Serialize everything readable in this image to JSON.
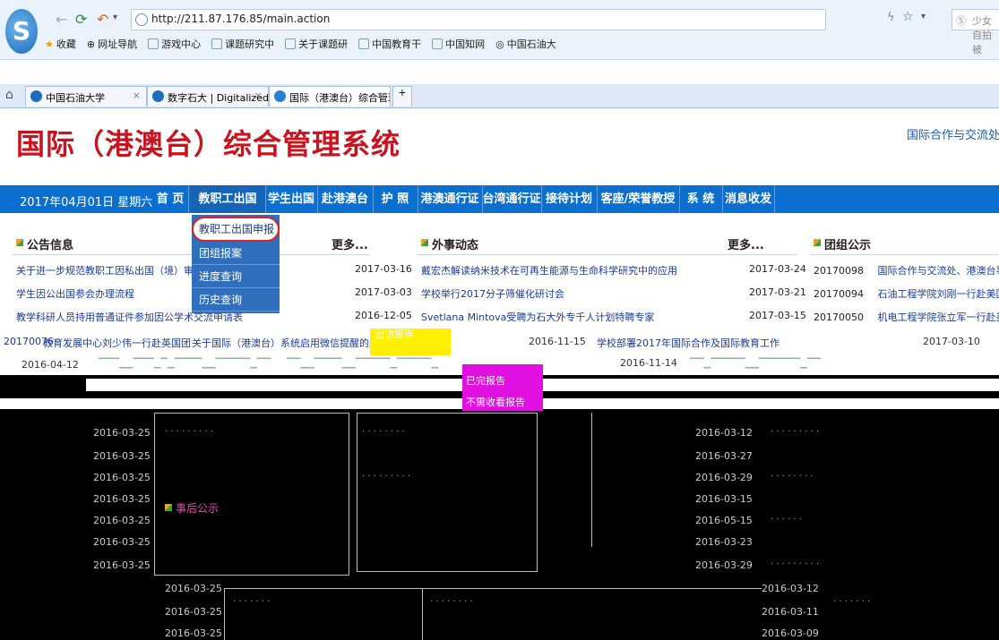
{
  "browser": {
    "url": "http://211.87.176.85/main.action",
    "right_search_text": "少女自拍被",
    "bookmarks": [
      "收藏",
      "网址导航",
      "游戏中心",
      "课题研究中",
      "关于课题研",
      "中国教育干",
      "中国知网",
      "中国石油大"
    ],
    "tabs": [
      {
        "label": "中国石油大学"
      },
      {
        "label": "数字石大 | Digitalized"
      },
      {
        "label": "国际（港澳台）综合管理"
      }
    ],
    "new_tab": "+"
  },
  "page": {
    "title": "国际（港澳台）综合管理系统",
    "top_right_link": "国际合作与交流处、",
    "date": "2017年04月01日 星期六",
    "menu": [
      "首 页",
      "教职工出国",
      "学生出国",
      "赴港澳台",
      "护 照",
      "港澳通行证",
      "台湾通行证",
      "接待计划",
      "客座/荣誉教授",
      "系 统",
      "消息收发"
    ],
    "dropdown": [
      "教职工出国申报",
      "团组报案",
      "进度查询",
      "历史查询"
    ],
    "panels": {
      "announcements": {
        "title": "公告信息",
        "more": "更多...",
        "rows": [
          {
            "text": "关于进一步规范教职工因私出国（境）审批程序的通知",
            "date": "2017-03-16"
          },
          {
            "text": "学生因公出国参会办理流程",
            "date": "2017-03-03"
          },
          {
            "text": "教学科研人员持用普通证件参加因公学术交流申请表",
            "date": "2016-12-05"
          }
        ]
      },
      "foreign": {
        "title": "外事动态",
        "more": "更多...",
        "rows": [
          {
            "text": "戴宏杰解读纳米技术在可再生能源与生命科学研究中的应用",
            "date": "2017-03-24"
          },
          {
            "text": "学校举行2017分子筛催化研讨会",
            "date": "2017-03-21"
          },
          {
            "text": "Svetlana Mintova受聘为石大外专千人计划特聘专家",
            "date": "2017-03-15"
          }
        ]
      },
      "groups": {
        "title": "团组公示",
        "rows": [
          {
            "code": "20170098",
            "text": "国际合作与交流处、港澳台事务办公室赵"
          },
          {
            "code": "20170094",
            "text": "石油工程学院刘刚一行赴美国团"
          },
          {
            "code": "20170050",
            "text": "机电工程学院张立军一行赴美国团"
          }
        ]
      }
    },
    "corrupted": {
      "row1": [
        {
          "text": "教育发展中心刘少伟一行赴英国团"
        },
        {
          "text": "关于国际（港澳台）系统启用微信提醒的通知"
        },
        {
          "text": "出访报告"
        },
        {
          "text": "2016-11-15"
        },
        {
          "text": "学校部署2017年国际合作及国际教育工作"
        },
        {
          "text": "2017-03-10"
        }
      ],
      "left_code": "20170076",
      "row2_date_left": "2016-04-12",
      "row2_date_mid": "2016-11-14",
      "pink_labels": [
        "已完报告",
        "不需收看报告"
      ],
      "mid_dates": [
        "2016-03-25",
        "2016-03-25",
        "2016-03-25",
        "2016-03-25",
        "2016-03-25",
        "2016-03-25",
        "2016-03-25"
      ],
      "right_dates": [
        "2016-03-12",
        "2016-03-27",
        "2016-03-29",
        "2016-03-15",
        "2016-05-15",
        "2016-03-23",
        "2016-03-29"
      ],
      "bottom_dates": [
        "2016-03-25",
        "2016-03-25",
        "2016-03-25"
      ],
      "bottom_right_dates": [
        "2016-03-12",
        "2016-03-11",
        "2016-03-09"
      ],
      "post_notice": "事后公示"
    }
  }
}
